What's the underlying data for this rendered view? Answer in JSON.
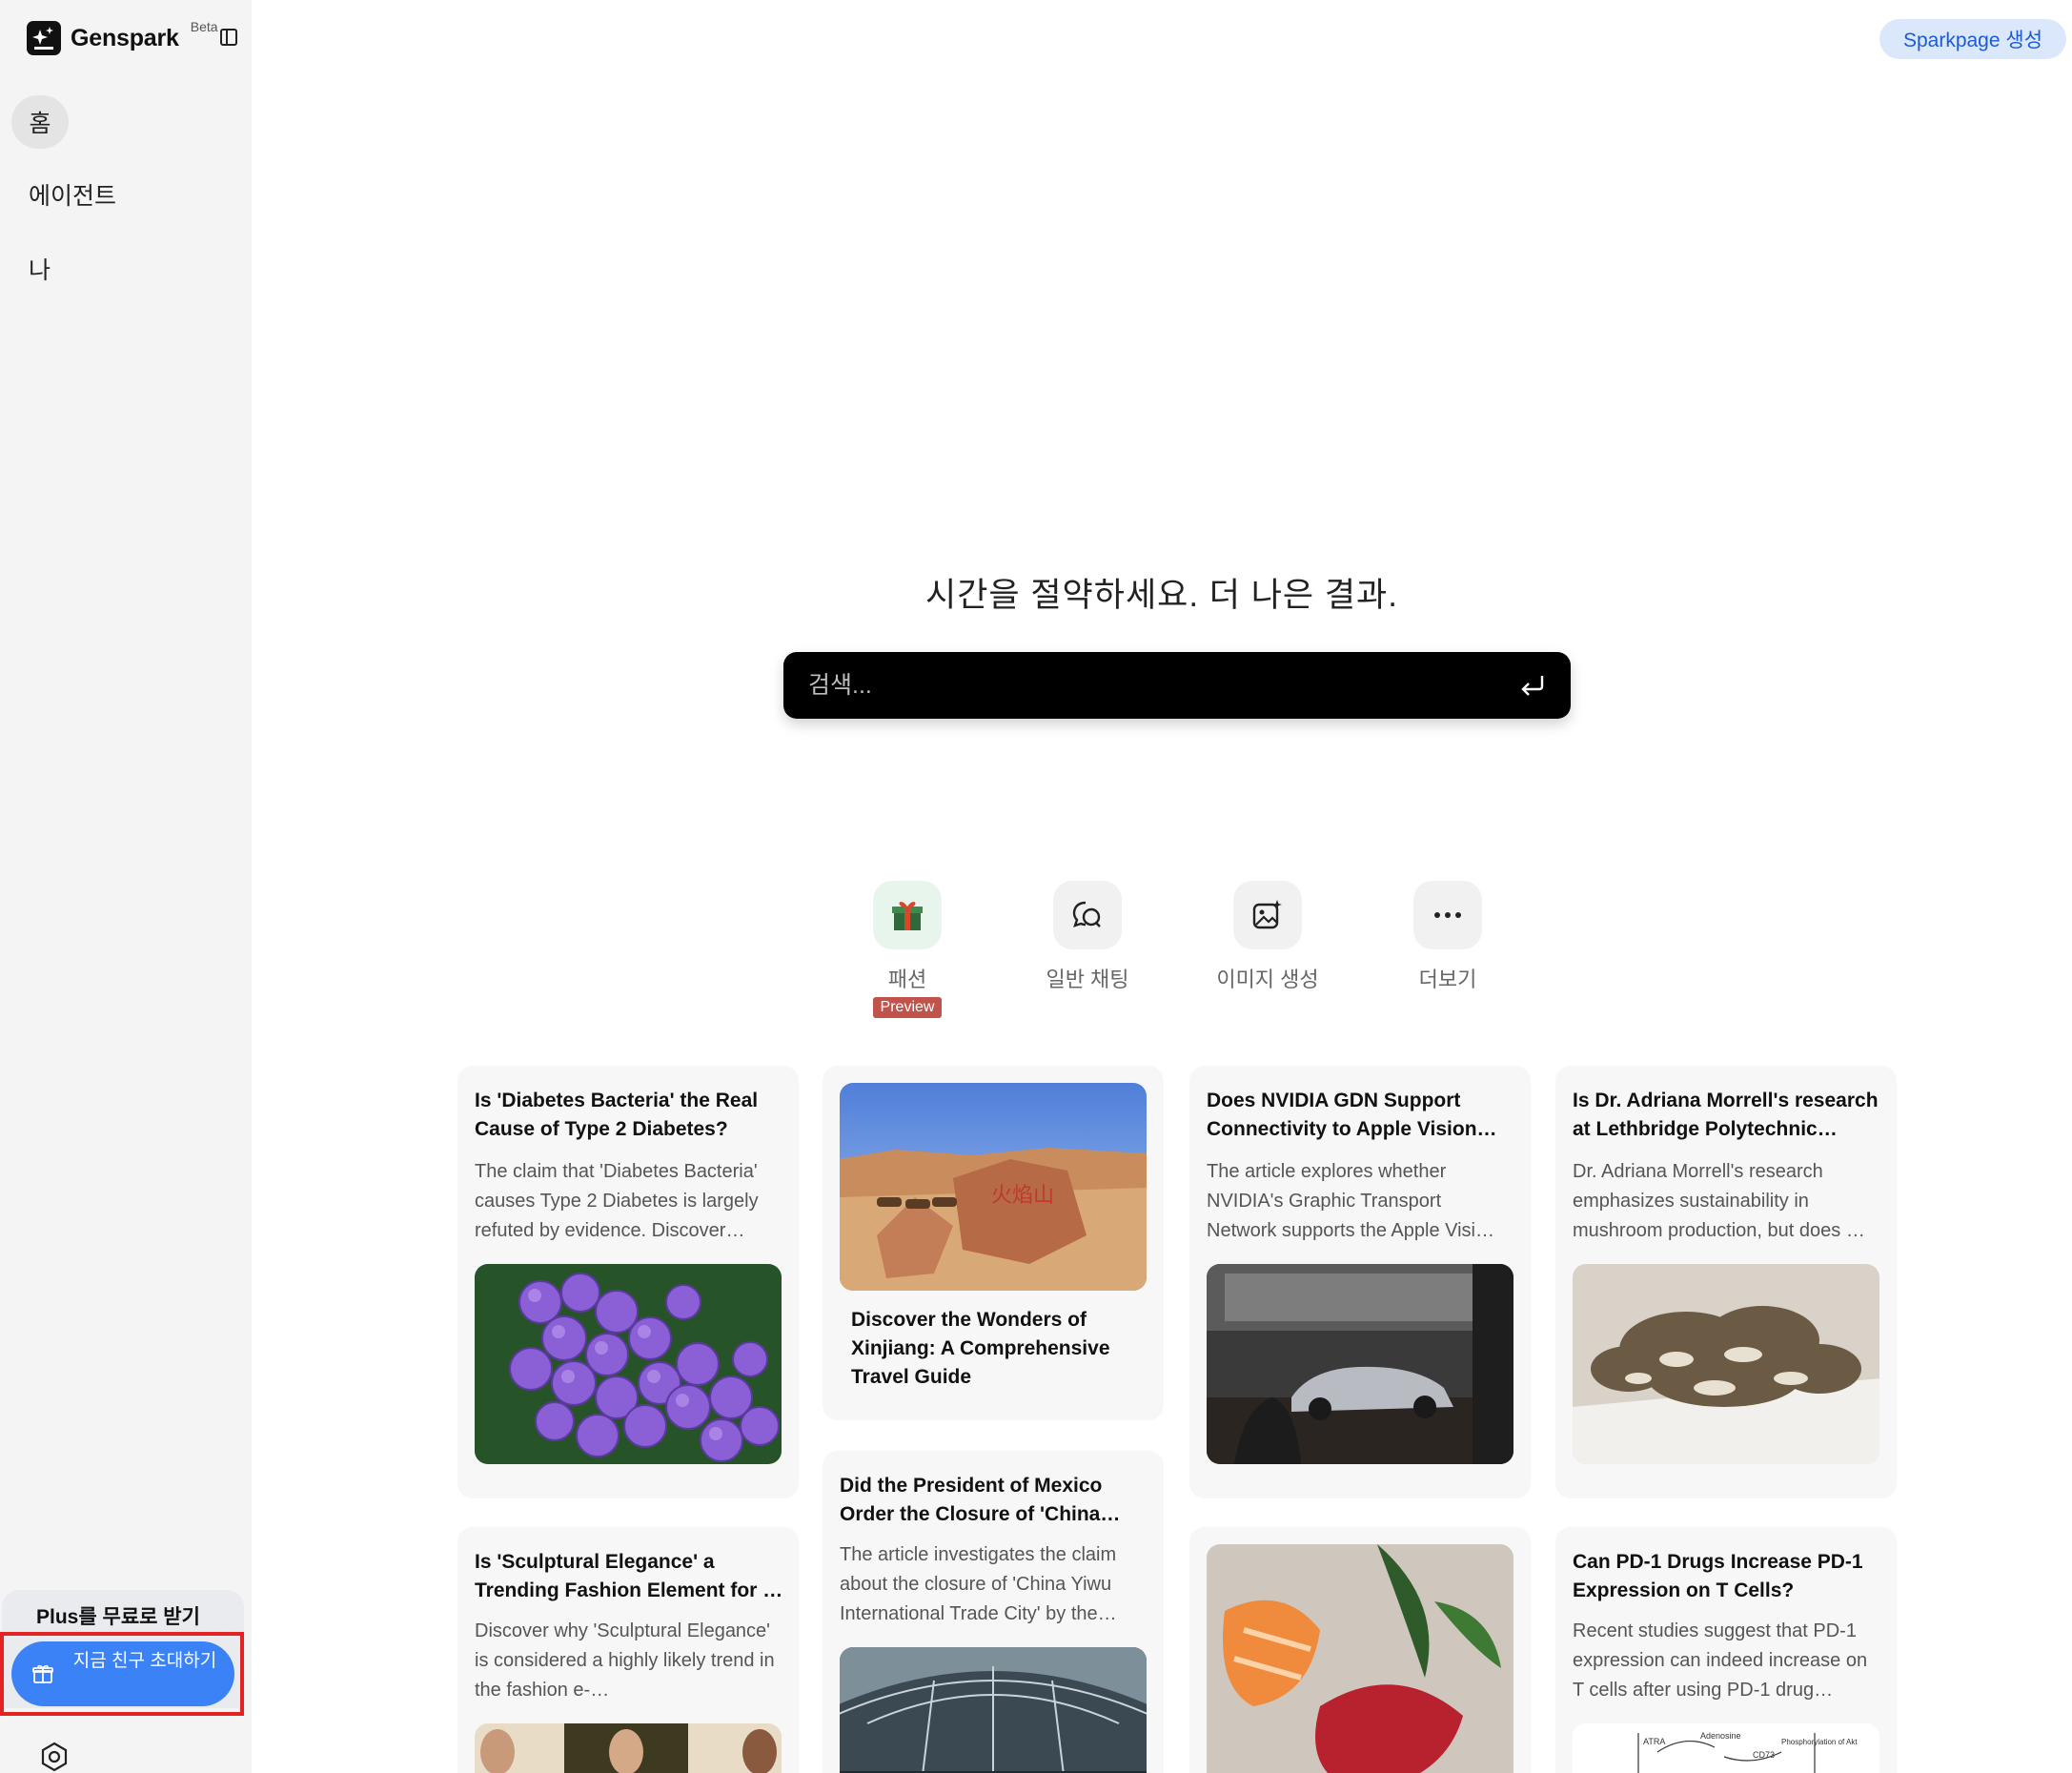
{
  "sidebar": {
    "logo_text": "Genspark",
    "beta_label": "Beta",
    "nav": [
      {
        "label": "홈"
      },
      {
        "label": "에이전트"
      },
      {
        "label": "나"
      }
    ],
    "promo_title": "Plus를 무료로 받기",
    "invite_button": "지금 친구 초대하기"
  },
  "header": {
    "sparkpage_button": "Sparkpage 생성"
  },
  "hero": {
    "title": "시간을 절약하세요. 더 나은 결과.",
    "search_placeholder": "검색..."
  },
  "quick_actions": [
    {
      "label": "패션",
      "badge": "Preview",
      "icon": "gift-icon"
    },
    {
      "label": "일반 채팅",
      "icon": "chat-icon"
    },
    {
      "label": "이미지 생성",
      "icon": "image-sparkle-icon"
    },
    {
      "label": "더보기",
      "icon": "more-icon"
    }
  ],
  "cards": [
    {
      "title": "Is 'Diabetes Bacteria' the Real Cause of Type 2 Diabetes?",
      "desc": "The claim that 'Diabetes Bacteria' causes Type 2 Diabetes is largely refuted by evidence. Discover…",
      "image": "bacteria-microscope-image"
    },
    {
      "title": "Discover the Wonders of Xinjiang: A Comprehensive Travel Guide",
      "image": "desert-camels-image"
    },
    {
      "title": "Does NVIDIA GDN Support Connectivity to Apple Vision…",
      "desc": "The article explores whether NVIDIA's Graphic Transport Network supports the Apple Visi…",
      "image": "vr-car-showroom-image"
    },
    {
      "title": "Is Dr. Adriana Morrell's research at Lethbridge Polytechnic…",
      "desc": "Dr. Adriana Morrell's research emphasizes sustainability in mushroom production, but does …",
      "image": "mushrooms-image"
    },
    {
      "title": "Is 'Sculptural Elegance' a Trending Fashion Element for …",
      "desc": "Discover why 'Sculptural Elegance' is considered a highly likely trend in the fashion e-…",
      "image": "fashion-models-image"
    },
    {
      "title": "Did the President of Mexico Order the Closure of 'China…",
      "desc": "The article investigates the claim about the closure of 'China Yiwu International Trade City' by the…",
      "image": "market-hall-image"
    },
    {
      "image": "sashimi-image"
    },
    {
      "title": "Can PD-1 Drugs Increase PD-1 Expression on T Cells?",
      "desc": "Recent studies suggest that PD-1 expression can indeed increase on T cells after using PD-1 drug…",
      "image": "pathway-diagram-image",
      "diagram_labels": [
        "ATRA",
        "Adenosine",
        "CD73",
        "Phosphorylation of Akt"
      ]
    }
  ],
  "colors": {
    "accent": "#3b82f6",
    "sidebar_bg": "#f4f4f4",
    "preview_badge": "#c0534b",
    "highlight_border": "#e32222"
  }
}
